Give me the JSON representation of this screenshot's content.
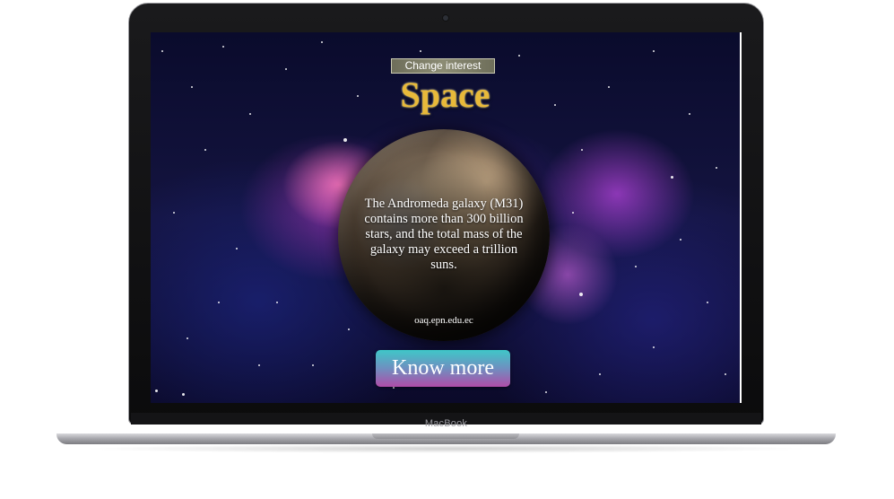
{
  "device": {
    "brand_label": "MacBook"
  },
  "page": {
    "change_interest_label": "Change interest",
    "interest_title": "Space",
    "fact_text": "The Andromeda galaxy (M31) contains more than 300 billion stars, and the total mass of the galaxy may exceed a trillion suns.",
    "source_link": "oaq.epn.edu.ec",
    "know_more_label": "Know more"
  },
  "colors": {
    "title_gold": "#e8b93a",
    "button_gradient_top": "#3fc7c8",
    "button_gradient_bottom": "#b04ca8",
    "space_background": "#141440"
  },
  "icons": {
    "camera": "camera-dot-icon",
    "planet": "planet-graphic"
  }
}
